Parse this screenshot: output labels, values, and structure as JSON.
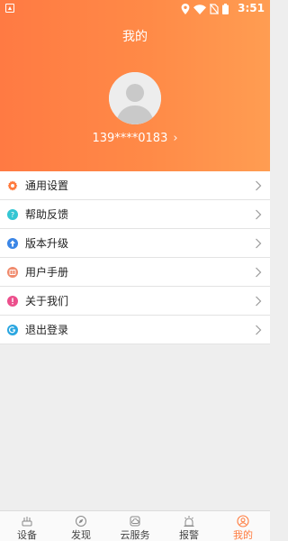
{
  "status_bar": {
    "time": "3:51"
  },
  "header": {
    "title": "我的",
    "phone": "139****0183"
  },
  "menu": {
    "items": [
      {
        "label": "通用设置",
        "icon": "gear-icon",
        "color": "#ff7a3d"
      },
      {
        "label": "帮助反馈",
        "icon": "help-icon",
        "color": "#34c6d3"
      },
      {
        "label": "版本升级",
        "icon": "upgrade-icon",
        "color": "#3b86e6"
      },
      {
        "label": "用户手册",
        "icon": "manual-icon",
        "color": "#f08a6c"
      },
      {
        "label": "关于我们",
        "icon": "info-icon",
        "color": "#ec4f8c"
      },
      {
        "label": "退出登录",
        "icon": "logout-icon",
        "color": "#2aa6e0"
      }
    ]
  },
  "tabbar": {
    "tabs": [
      {
        "label": "设备",
        "icon": "device-icon"
      },
      {
        "label": "发现",
        "icon": "discover-icon"
      },
      {
        "label": "云服务",
        "icon": "cloud-service-icon"
      },
      {
        "label": "报警",
        "icon": "alarm-icon"
      },
      {
        "label": "我的",
        "icon": "profile-icon",
        "active": true
      }
    ]
  },
  "colors": {
    "accent": "#ff7a3d",
    "header_start": "#ff7a43",
    "header_end": "#ff9d52"
  }
}
